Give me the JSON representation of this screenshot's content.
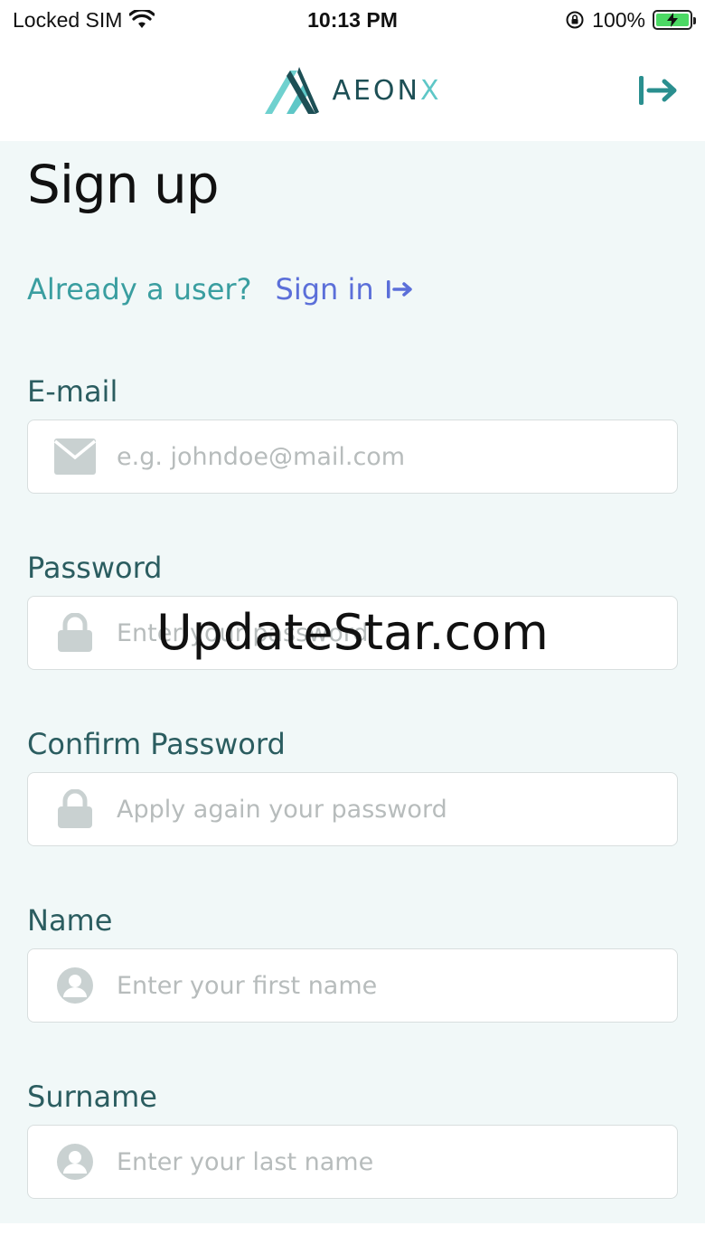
{
  "status": {
    "carrier": "Locked SIM",
    "time": "10:13 PM",
    "battery": "100%"
  },
  "header": {
    "logo_main": "AEON",
    "logo_accent": "X"
  },
  "page": {
    "title": "Sign up",
    "already_user": "Already a user?",
    "signin_link": "Sign in"
  },
  "form": {
    "email": {
      "label": "E-mail",
      "placeholder": "e.g. johndoe@mail.com",
      "icon": "mail-icon"
    },
    "password": {
      "label": "Password",
      "placeholder": "Enter your password",
      "icon": "lock-icon"
    },
    "confirm": {
      "label": "Confirm Password",
      "placeholder": "Apply again your password",
      "icon": "lock-icon"
    },
    "name": {
      "label": "Name",
      "placeholder": "Enter your first name",
      "icon": "user-icon"
    },
    "surname": {
      "label": "Surname",
      "placeholder": "Enter your last name",
      "icon": "user-icon"
    }
  },
  "watermark": "UpdateStar.com",
  "colors": {
    "teal": "#3a9ea0",
    "link": "#5b6fd9",
    "label": "#2b5d60",
    "background": "#f1f8f8"
  }
}
